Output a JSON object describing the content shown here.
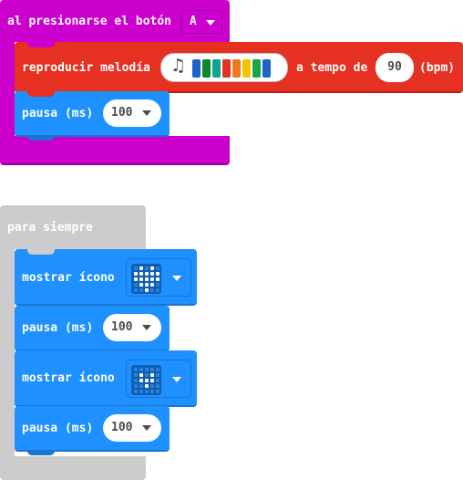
{
  "event_block": {
    "label": "al presionarse el botón",
    "button_value": "A",
    "color": "#cc00cc"
  },
  "melody_block": {
    "label": "reproducir melodía",
    "tempo_label": "a tempo de",
    "tempo_value": "90",
    "unit": "(bpm)",
    "color": "#e63022",
    "melody_colors": [
      "#1e64c8",
      "#0b8a2c",
      "#14a094",
      "#e63022",
      "#ec7a1c",
      "#f5c400",
      "#1aa54a",
      "#1e64c8"
    ]
  },
  "pause_blocks": [
    {
      "label": "pausa (ms)",
      "value": "100"
    },
    {
      "label": "pausa (ms)",
      "value": "100"
    },
    {
      "label": "pausa (ms)",
      "value": "100"
    }
  ],
  "forever_block": {
    "label": "para siempre",
    "color": "#cccccc"
  },
  "show_icon_blocks": [
    {
      "label": "mostrar ícono",
      "icon": "heart-icon"
    },
    {
      "label": "mostrar ícono",
      "icon": "small-heart-icon"
    }
  ],
  "basic_color": "#1e90ff",
  "dropdown_icon": "triangle-down-icon",
  "music_icon": "music-note-icon"
}
